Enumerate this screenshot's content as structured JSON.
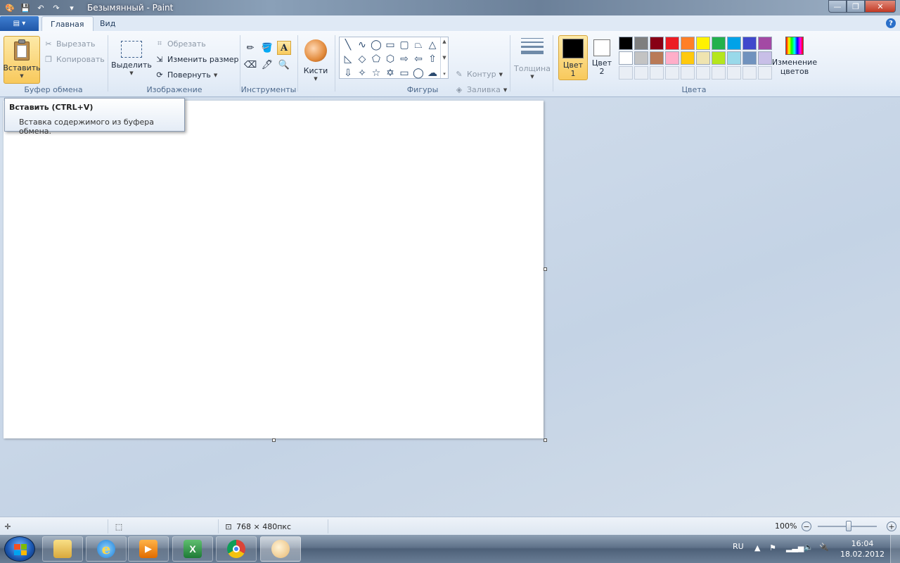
{
  "window": {
    "title": "Безымянный - Paint",
    "min_glyph": "—",
    "max_glyph": "❐",
    "close_glyph": "✕"
  },
  "tabs": {
    "app_menu_glyph": "▤ ▾",
    "home": "Главная",
    "view": "Вид",
    "help_glyph": "?"
  },
  "ribbon": {
    "clipboard": {
      "label": "Буфер обмена",
      "paste": "Вставить",
      "cut": "Вырезать",
      "copy": "Копировать"
    },
    "image": {
      "label": "Изображение",
      "select": "Выделить",
      "crop": "Обрезать",
      "resize": "Изменить размер",
      "rotate": "Повернуть"
    },
    "tools": {
      "label": "Инструменты",
      "text_tool_glyph": "A"
    },
    "brushes": {
      "label": "Кисти"
    },
    "shapes": {
      "label": "Фигуры",
      "outline": "Контур",
      "fill": "Заливка"
    },
    "thickness": {
      "label": "Толщина"
    },
    "colors": {
      "label": "Цвета",
      "color1_line1": "Цвет",
      "color1_line2": "1",
      "color2_line1": "Цвет",
      "color2_line2": "2",
      "color1_value": "#000000",
      "color2_value": "#ffffff",
      "edit_line1": "Изменение",
      "edit_line2": "цветов",
      "palette": [
        "#000000",
        "#7f7f7f",
        "#880015",
        "#ed1c24",
        "#ff7f27",
        "#fff200",
        "#22b14c",
        "#00a2e8",
        "#3f48cc",
        "#a349a4",
        "#ffffff",
        "#c3c3c3",
        "#b97a57",
        "#ffaec9",
        "#ffc90e",
        "#efe4b0",
        "#b5e61d",
        "#99d9ea",
        "#7092be",
        "#c8bfe7"
      ]
    }
  },
  "tooltip": {
    "title": "Вставить (CTRL+V)",
    "description": "Вставка содержимого из буфера обмена."
  },
  "statusbar": {
    "canvas_size": "768 × 480пкс",
    "zoom": "100%",
    "zoom_level": 1.0
  },
  "taskbar": {
    "lang": "RU",
    "time": "16:04",
    "date": "18.02.2012"
  }
}
